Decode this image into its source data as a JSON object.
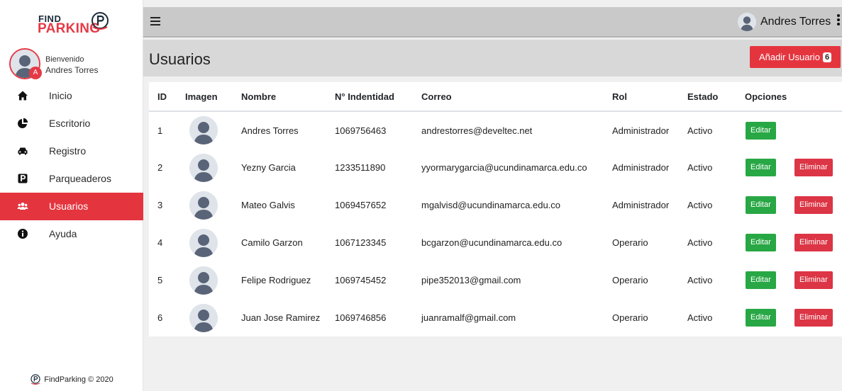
{
  "brand": {
    "line1": "FIND",
    "line2": "PARKING"
  },
  "sidebar": {
    "welcome": "Bienvenido",
    "user_name": "Andres Torres",
    "avatar_badge": "A",
    "items": [
      {
        "label": "Inicio",
        "icon": "home-icon"
      },
      {
        "label": "Escritorio",
        "icon": "chart-pie-icon"
      },
      {
        "label": "Registro",
        "icon": "car-icon"
      },
      {
        "label": "Parqueaderos",
        "icon": "parking-icon"
      },
      {
        "label": "Usuarios",
        "icon": "users-icon",
        "active": true
      },
      {
        "label": "Ayuda",
        "icon": "info-icon"
      }
    ],
    "footer": "FindParking © 2020"
  },
  "topbar": {
    "user_name": "Andres Torres"
  },
  "page": {
    "title": "Usuarios",
    "add_button": "Añadir Usuario",
    "add_badge": "6"
  },
  "table": {
    "headers": [
      "ID",
      "Imagen",
      "Nombre",
      "N° Indentidad",
      "Correo",
      "Rol",
      "Estado",
      "Opciones"
    ],
    "edit_label": "Editar",
    "delete_label": "Eliminar",
    "rows": [
      {
        "id": "1",
        "name": "Andres Torres",
        "doc": "1069756463",
        "email": "andrestorres@develtec.net",
        "role": "Administrador",
        "status": "Activo",
        "can_delete": false
      },
      {
        "id": "2",
        "name": "Yezny Garcia",
        "doc": "1233511890",
        "email": "yyormarygarcia@ucundinamarca.edu.co",
        "role": "Administrador",
        "status": "Activo",
        "can_delete": true
      },
      {
        "id": "3",
        "name": "Mateo Galvis",
        "doc": "1069457652",
        "email": "mgalvisd@ucundinamarca.edu.co",
        "role": "Administrador",
        "status": "Activo",
        "can_delete": true
      },
      {
        "id": "4",
        "name": "Camilo Garzon",
        "doc": "1067123345",
        "email": "bcgarzon@ucundinamarca.edu.co",
        "role": "Operario",
        "status": "Activo",
        "can_delete": true
      },
      {
        "id": "5",
        "name": "Felipe Rodriguez",
        "doc": "1069745452",
        "email": "pipe352013@gmail.com",
        "role": "Operario",
        "status": "Activo",
        "can_delete": true
      },
      {
        "id": "6",
        "name": "Juan Jose Ramirez",
        "doc": "1069746856",
        "email": "juanramalf@gmail.com",
        "role": "Operario",
        "status": "Activo",
        "can_delete": true
      }
    ]
  },
  "colors": {
    "accent": "#e4353f",
    "edit": "#28a745",
    "delete": "#dc3545",
    "topbar": "#c9c9c9",
    "titlebar": "#d8d8d8"
  }
}
